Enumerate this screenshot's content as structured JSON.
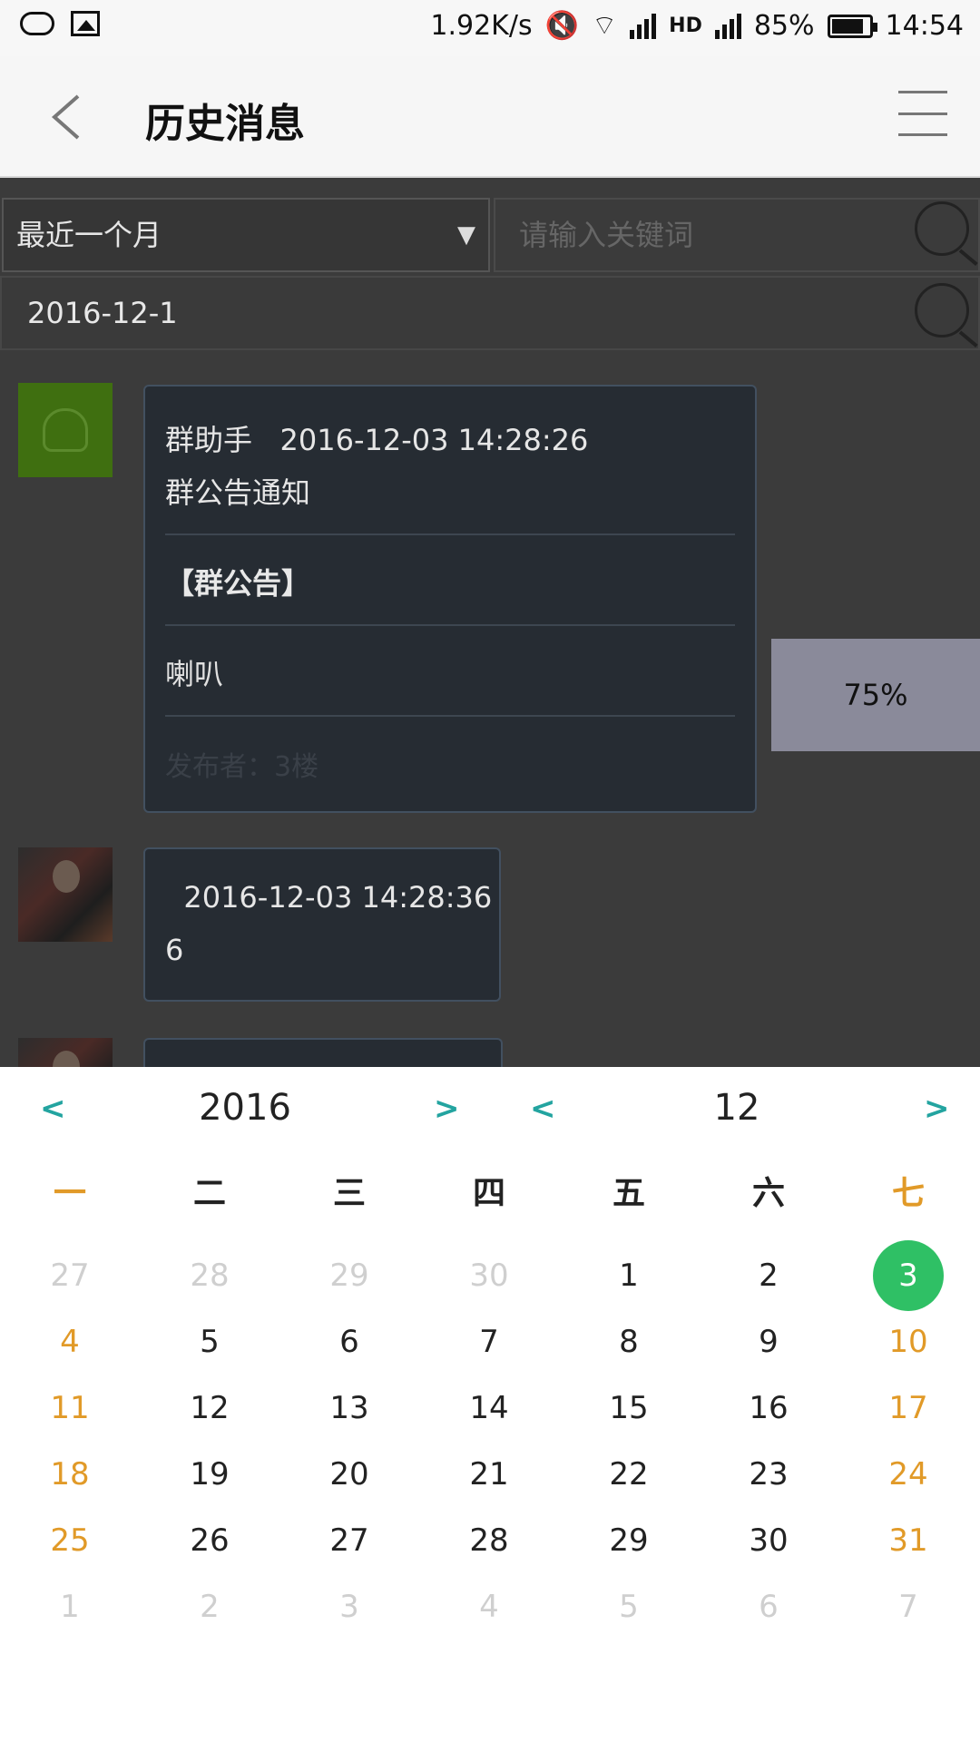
{
  "status_bar": {
    "speed": "1.92K/s",
    "battery": "85%",
    "time": "14:54",
    "hd": "HD"
  },
  "header": {
    "title": "历史消息"
  },
  "filter": {
    "range_value": "最近一个月",
    "keyword_placeholder": "请输入关键词",
    "date_value": "2016-12-1"
  },
  "messages": [
    {
      "sender": "群助手",
      "time": "2016-12-03 14:28:26",
      "type": "群公告通知",
      "notice_title": "【群公告】",
      "notice_body": "喇叭",
      "footer": "发布者：3楼"
    },
    {
      "sender": "",
      "time": "2016-12-03 14:28:36",
      "text": "6"
    }
  ],
  "progress": {
    "label": "75%",
    "value": 0.75
  },
  "calendar": {
    "year": "2016",
    "month": "12",
    "prev_label": "<",
    "next_label": ">",
    "weekdays": [
      "一",
      "二",
      "三",
      "四",
      "五",
      "六",
      "七"
    ],
    "weeks": [
      [
        "27",
        "28",
        "29",
        "30",
        "1",
        "2",
        "3"
      ],
      [
        "4",
        "5",
        "6",
        "7",
        "8",
        "9",
        "10"
      ],
      [
        "11",
        "12",
        "13",
        "14",
        "15",
        "16",
        "17"
      ],
      [
        "18",
        "19",
        "20",
        "21",
        "22",
        "23",
        "24"
      ],
      [
        "25",
        "26",
        "27",
        "28",
        "29",
        "30",
        "31"
      ],
      [
        "1",
        "2",
        "3",
        "4",
        "5",
        "6",
        "7"
      ]
    ],
    "muted_cells": [
      [
        0,
        0
      ],
      [
        0,
        1
      ],
      [
        0,
        2
      ],
      [
        0,
        3
      ],
      [
        5,
        0
      ],
      [
        5,
        1
      ],
      [
        5,
        2
      ],
      [
        5,
        3
      ],
      [
        5,
        4
      ],
      [
        5,
        5
      ],
      [
        5,
        6
      ]
    ],
    "selected_cell": [
      0,
      6
    ],
    "weekend_color": "#e19a28",
    "selected_color": "#2fc065",
    "nav_color": "#23a4a0"
  }
}
